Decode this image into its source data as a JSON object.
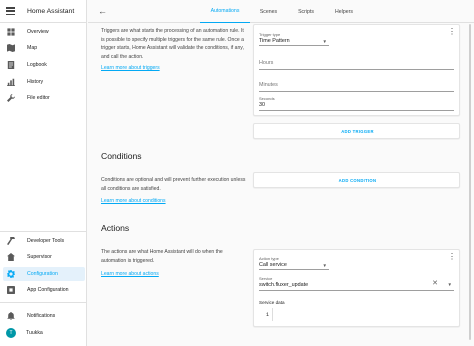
{
  "app": {
    "title": "Home Assistant"
  },
  "sidebar": {
    "items": [
      {
        "label": "Overview",
        "icon": "overview-icon"
      },
      {
        "label": "Map",
        "icon": "map-icon"
      },
      {
        "label": "Logbook",
        "icon": "logbook-icon"
      },
      {
        "label": "History",
        "icon": "history-icon"
      },
      {
        "label": "File editor",
        "icon": "wrench-icon"
      }
    ],
    "bottom_items": [
      {
        "label": "Developer Tools",
        "icon": "hammer-icon"
      },
      {
        "label": "Supervisor",
        "icon": "supervisor-icon"
      },
      {
        "label": "Configuration",
        "icon": "gear-icon"
      },
      {
        "label": "App Configuration",
        "icon": "app-config-icon"
      },
      {
        "label": "Notifications",
        "icon": "bell-icon"
      }
    ],
    "user": {
      "initial": "T",
      "name": "Tuukka"
    }
  },
  "tabs": [
    "Automations",
    "Scenes",
    "Scripts",
    "Helpers"
  ],
  "active_tab": "Automations",
  "triggers": {
    "description": [
      "Triggers are what starts the processing of an automation rule. It",
      "is possible to specify multiple triggers for the same rule. Once a",
      "trigger starts, Home Assistant will validate the conditions, if any,",
      "and call the action."
    ],
    "learn_more": "Learn more about triggers",
    "card": {
      "type_label": "Trigger type",
      "type_value": "Time Pattern",
      "hours_placeholder": "Hours",
      "minutes_placeholder": "Minutes",
      "seconds_label": "Seconds",
      "seconds_value": "30"
    },
    "add_button": "ADD TRIGGER"
  },
  "conditions": {
    "heading": "Conditions",
    "description": [
      "Conditions are optional and will prevent further execution unless",
      "all conditions are satisfied."
    ],
    "learn_more": "Learn more about conditions",
    "add_button": "ADD CONDITION"
  },
  "actions": {
    "heading": "Actions",
    "description": [
      "The actions are what Home Assistant will do when the",
      "automation is triggered."
    ],
    "learn_more": "Learn more about actions",
    "card": {
      "type_label": "Action type",
      "type_value": "Call service",
      "service_label": "Service",
      "service_value": "switch.fluxer_update",
      "service_data_label": "Service data",
      "line_number": "1"
    }
  },
  "colors": {
    "accent": "#03a9f4",
    "avatar": "#0097a7",
    "active_bg": "#e4f1fb"
  }
}
